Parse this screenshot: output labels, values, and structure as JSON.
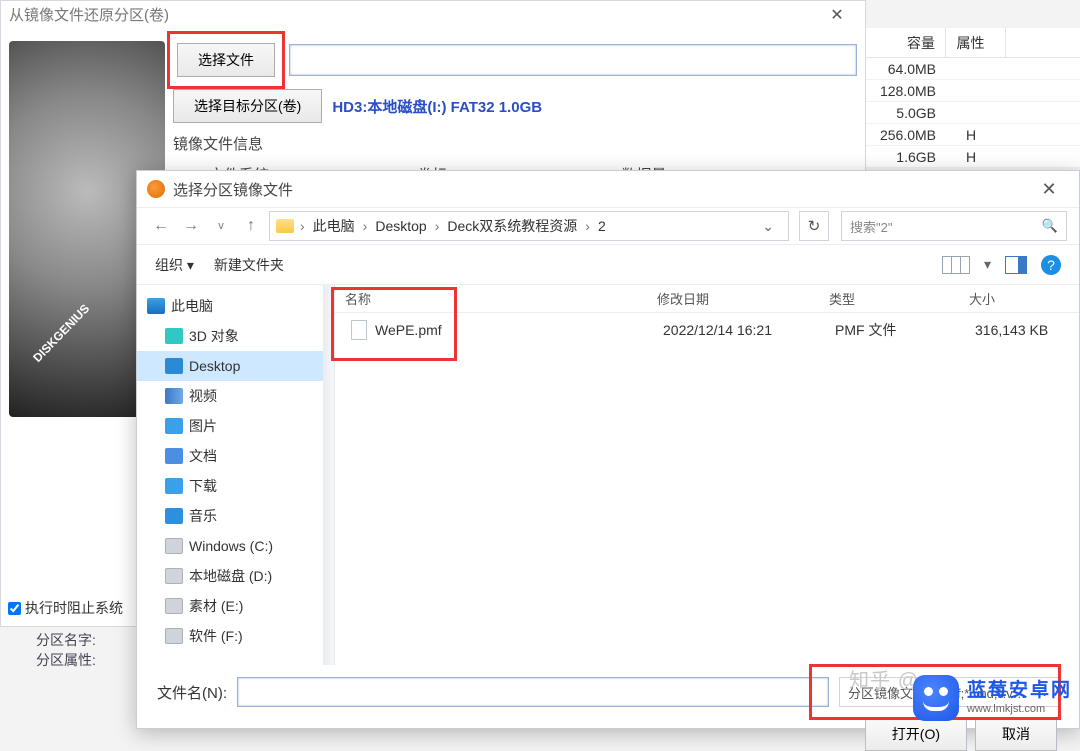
{
  "restore": {
    "title": "从镜像文件还原分区(卷)",
    "select_file_btn": "选择文件",
    "select_target_btn": "选择目标分区(卷)",
    "target_path": "HD3:本地磁盘(I:) FAT32 1.0GB",
    "info_title": "镜像文件信息",
    "fs_label": "文件系统:",
    "vol_label": "卷标:",
    "data_label": "数据量:",
    "block_checkbox": "执行时阻止系统",
    "fz_name": "分区名字:",
    "fz_attr": "分区属性:"
  },
  "capacity": {
    "hdr_size": "容量",
    "hdr_attr": "属性",
    "rows": [
      {
        "size": "64.0MB",
        "attr": ""
      },
      {
        "size": "128.0MB",
        "attr": ""
      },
      {
        "size": "5.0GB",
        "attr": ""
      },
      {
        "size": "256.0MB",
        "attr": "H"
      },
      {
        "size": "1.6GB",
        "attr": "H"
      }
    ]
  },
  "open": {
    "title": "选择分区镜像文件",
    "crumbs": [
      "此电脑",
      "Desktop",
      "Deck双系统教程资源",
      "2"
    ],
    "search_placeholder": "搜索\"2\"",
    "organize": "组织 ▾",
    "new_folder": "新建文件夹",
    "tree": {
      "pc": "此电脑",
      "threeD": "3D 对象",
      "desktop": "Desktop",
      "video": "视频",
      "pic": "图片",
      "doc": "文档",
      "dl": "下载",
      "music": "音乐",
      "drvC": "Windows (C:)",
      "drvD": "本地磁盘 (D:)",
      "drvE": "素材 (E:)",
      "drvF": "软件 (F:)"
    },
    "file_hdr": {
      "name": "名称",
      "date": "修改日期",
      "type": "类型",
      "size": "大小"
    },
    "file_row": {
      "name": "WePE.pmf",
      "date": "2022/12/14 16:21",
      "type": "PMF 文件",
      "size": "316,143 KB"
    },
    "filename_label": "文件名(N):",
    "filter": "分区镜像文件(*.pmf;*.vhd;*.v…",
    "open_btn": "打开(O)",
    "cancel_btn": "取消"
  },
  "watermark": "知乎 @…",
  "brand": {
    "name": "蓝莓安卓网",
    "url": "www.lmkjst.com"
  },
  "diskgenius_badge": "DISKGENIUS"
}
